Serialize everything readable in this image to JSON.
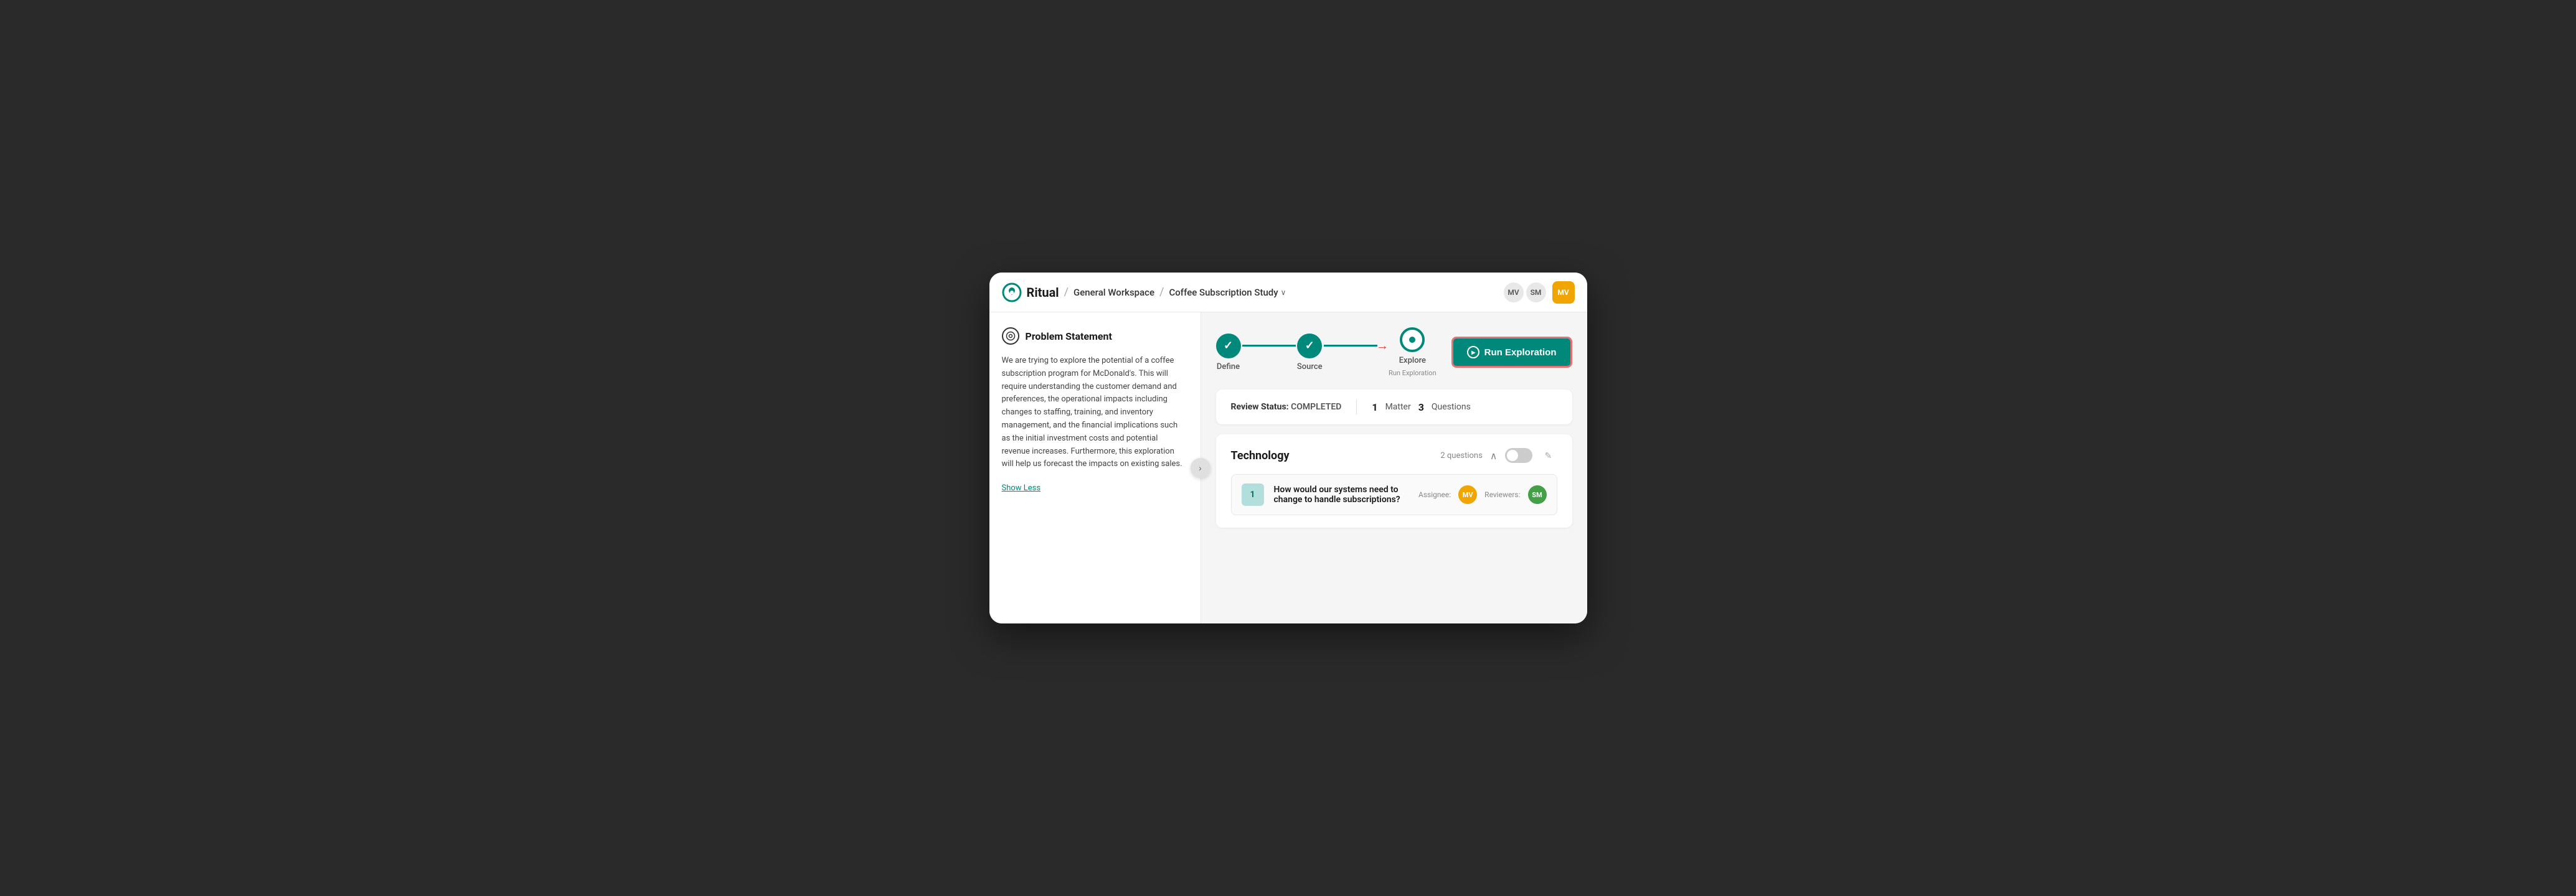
{
  "app": {
    "logo_text": "Ritual"
  },
  "header": {
    "breadcrumb_sep1": "/",
    "workspace": "General Workspace",
    "breadcrumb_sep2": "/",
    "study": "Coffee Subscription Study",
    "avatar1_initials": "MV",
    "avatar2_initials": "SM",
    "avatar3_initials": "MV"
  },
  "sidebar": {
    "title": "Problem Statement",
    "content": "We are trying to explore the potential of a coffee subscription program for McDonald's. This will require understanding the customer demand and preferences, the operational impacts including changes to staffing, training, and inventory management, and the financial implications such as the initial investment costs and potential revenue increases. Furthermore, this exploration will help us forecast the impacts on existing sales.",
    "show_less": "Show Less"
  },
  "progress": {
    "steps": [
      {
        "label": "Define",
        "state": "completed"
      },
      {
        "label": "Source",
        "state": "completed"
      },
      {
        "label": "Explore",
        "state": "current",
        "sublabel": "Run Exploration"
      }
    ],
    "run_btn_label": "Run Exploration"
  },
  "status_bar": {
    "review_label": "Review Status:",
    "review_value": "COMPLETED",
    "matter_count": "1",
    "matter_label": "Matter",
    "questions_count": "3",
    "questions_label": "Questions"
  },
  "technology": {
    "title": "Technology",
    "questions_count": "2 questions",
    "question1": {
      "num": "1",
      "text": "How would our systems need to change to handle subscriptions?",
      "assignee_label": "Assignee:",
      "assignee_initials": "MV",
      "reviewers_label": "Reviewers:",
      "reviewer_initials": "SM"
    }
  },
  "icons": {
    "check": "✓",
    "chevron_down": "∨",
    "chevron_right": "›",
    "chevron_up": "∧",
    "play": "▶",
    "edit": "✎",
    "arrow_right": "→",
    "problem_icon": "◎"
  }
}
